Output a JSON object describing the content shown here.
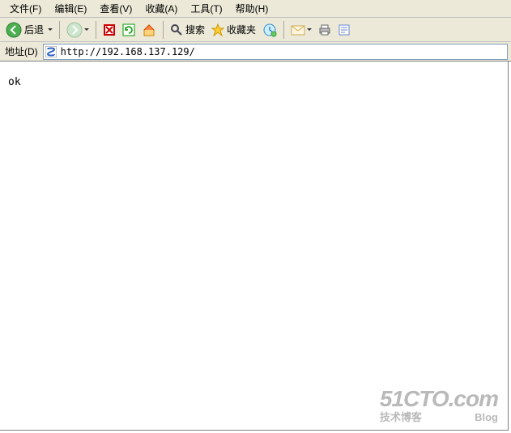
{
  "menubar": {
    "file": "文件(F)",
    "edit": "编辑(E)",
    "view": "查看(V)",
    "favorites": "收藏(A)",
    "tools": "工具(T)",
    "help": "帮助(H)"
  },
  "toolbar": {
    "back_label": "后退",
    "search_label": "搜索",
    "favorites_label": "收藏夹"
  },
  "addressbar": {
    "label": "地址(D)",
    "url": "http://192.168.137.129/"
  },
  "page": {
    "body_text": "ok"
  },
  "watermark": {
    "main": "51CTO.com",
    "sub_left": "技术博客",
    "sub_right": "Blog"
  }
}
